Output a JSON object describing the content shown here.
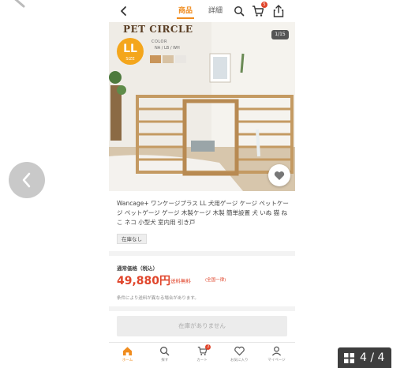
{
  "header": {
    "tab_product": "商品",
    "tab_detail": "詳細",
    "cart_count": "5"
  },
  "image": {
    "counter": "1/15",
    "brand_title": "PET CIRCLE",
    "size_badge": "LL",
    "size_badge_sub": "SIZE",
    "color_label": "COLOR",
    "color_values": "NA / LB / WH"
  },
  "product": {
    "title": "Wancage+ ワンケージプラス LL 犬用ゲージ ケージ ペットケージ ペットゲージ ゲージ 木製ケージ 木製 簡単設置 犬 いぬ 猫 ねこ ネコ 小型犬 室内用 引き戸",
    "stock_tag": "在庫なし"
  },
  "price": {
    "label": "通常価格（税込）",
    "value": "49,880円",
    "shipping": "送料無料",
    "shipping_note": "(全国一律)",
    "fee_note": "条件により送料が異なる場合があります。"
  },
  "cta": {
    "out_of_stock": "在庫がありません"
  },
  "bottom_nav": {
    "items": [
      {
        "label": "ホーム",
        "icon": "home-icon"
      },
      {
        "label": "探す",
        "icon": "search-icon"
      },
      {
        "label": "カート",
        "icon": "cart-icon",
        "badge": "2"
      },
      {
        "label": "お気に入り",
        "icon": "heart-icon"
      },
      {
        "label": "マイページ",
        "icon": "user-icon"
      }
    ]
  },
  "gallery": {
    "counter": "4 / 4"
  },
  "colors": {
    "accent": "#f08c1e",
    "price": "#e0452b",
    "size_badge": "#f4a61c"
  }
}
